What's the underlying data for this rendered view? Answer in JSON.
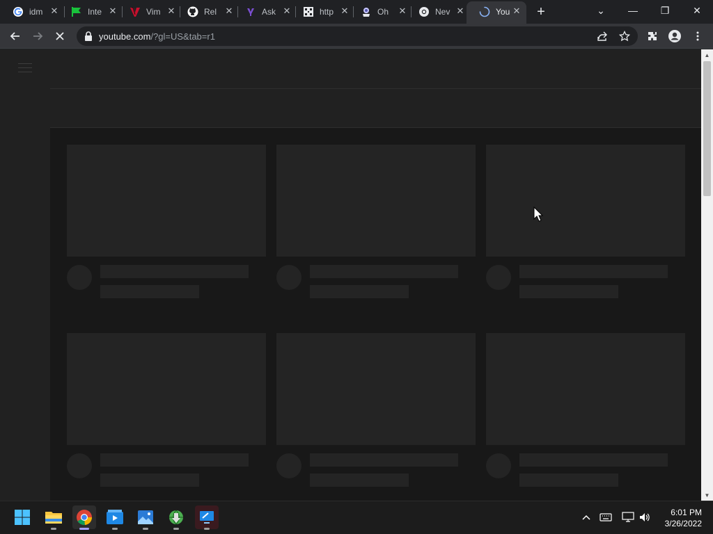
{
  "browser": {
    "tabs": [
      {
        "title": "idm",
        "favicon": "google-icon",
        "active": false
      },
      {
        "title": "Inte",
        "favicon": "green-flag-icon",
        "active": false
      },
      {
        "title": "Vim",
        "favicon": "vim-icon",
        "active": false
      },
      {
        "title": "Rel",
        "favicon": "github-icon",
        "active": false
      },
      {
        "title": "Ask",
        "favicon": "yahoo-icon",
        "active": false
      },
      {
        "title": "http",
        "favicon": "qr-icon",
        "active": false
      },
      {
        "title": "Oh",
        "favicon": "stack-icon",
        "active": false
      },
      {
        "title": "Nev",
        "favicon": "chrome-icon",
        "active": false
      },
      {
        "title": "You",
        "favicon": "loading-spinner-icon",
        "active": true
      }
    ],
    "new_tab_label": "+",
    "window_controls": {
      "tab_search": "⌄",
      "minimize": "—",
      "restore": "❐",
      "close": "✕"
    },
    "toolbar": {
      "back": "←",
      "forward": "→",
      "reload_stop": "✕"
    },
    "omnibox": {
      "host": "youtube.com",
      "path": "/?gl=US&tab=r1"
    },
    "colors": {
      "tab_strip": "#202124",
      "toolbar": "#35363a",
      "omnibox": "#202124"
    }
  },
  "page": {
    "state": "loading-skeleton",
    "colors": {
      "background": "#181818",
      "placeholder": "#242424",
      "chrome": "#212121"
    }
  },
  "taskbar": {
    "apps": [
      {
        "name": "start-button-icon",
        "running": false
      },
      {
        "name": "file-explorer-icon",
        "running": true
      },
      {
        "name": "chrome-icon",
        "running": true,
        "focused": true
      },
      {
        "name": "media-player-icon",
        "running": true
      },
      {
        "name": "photos-icon",
        "running": true
      },
      {
        "name": "idm-icon",
        "running": true
      },
      {
        "name": "remote-desktop-icon",
        "running": true
      }
    ],
    "tray": {
      "overflow": "^"
    },
    "clock": {
      "time": "6:01 PM",
      "date": "3/26/2022"
    }
  }
}
